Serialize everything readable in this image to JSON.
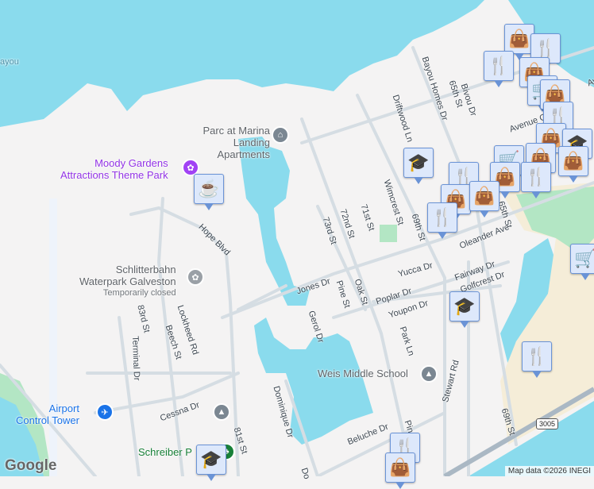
{
  "colors": {
    "water": "#8adbed",
    "land": "#f4f3f3",
    "road": "#d5dde3",
    "park": "#b3e6c4",
    "sand": "#f5edd8",
    "pin_fill": "#dde8fb",
    "pin_icon": "#0b3d63"
  },
  "water_labels": {
    "bayou": "ayou"
  },
  "pois": {
    "parc": "Parc at Marina Landing Apartments",
    "moody_1": "Moody Gardens",
    "moody_2": "Attractions Theme Park",
    "schlitter_1": "Schlitterbahn",
    "schlitter_2": "Waterpark Galveston",
    "schlitter_status": "Temporarily closed",
    "airport_1": "Airport",
    "airport_2": "Control Tower",
    "weis": "Weis Middle School",
    "schreiber": "Schreiber P"
  },
  "streets": {
    "hope": "Hope Blvd",
    "lockheed": "Lockheed Rd",
    "beech": "Beech St",
    "s83": "83rd St",
    "terminal": "Terminal Dr",
    "cessna": "Cessna Dr",
    "s81": "81st St",
    "dominique": "Dominique Dr",
    "do": "Do",
    "jones": "Jones Dr",
    "gerol": "Gerol Dr",
    "pine": "Pine St",
    "oak": "Oak St",
    "poplar": "Poplar Dr",
    "youpon": "Youpon Dr",
    "yucca": "Yucca Dr",
    "s73": "73rd St",
    "s72": "72nd St",
    "s71": "71st St",
    "wimcrest": "Wimcrest St",
    "s69": "69th St",
    "driftwood": "Driftwood Ln",
    "bayou_homes": "Bayou Homes Dr",
    "s65": "65th St",
    "bivou": "Bivou Dr",
    "avenue_q": "Avenue Q",
    "av": "Av",
    "oleander": "Oleander Ave",
    "s65b": "65th St",
    "fairway": "Fairway Dr",
    "golfcrest": "Golfcrest Dr",
    "park_ln": "Park Ln",
    "stewart": "Stewart Rd",
    "s69b": "69th St",
    "beluche": "Beluche Dr",
    "pin_st": "Pin"
  },
  "highway_shield": "3005",
  "attribution": "Map data ©2026 INEGI",
  "logo": "Google"
}
